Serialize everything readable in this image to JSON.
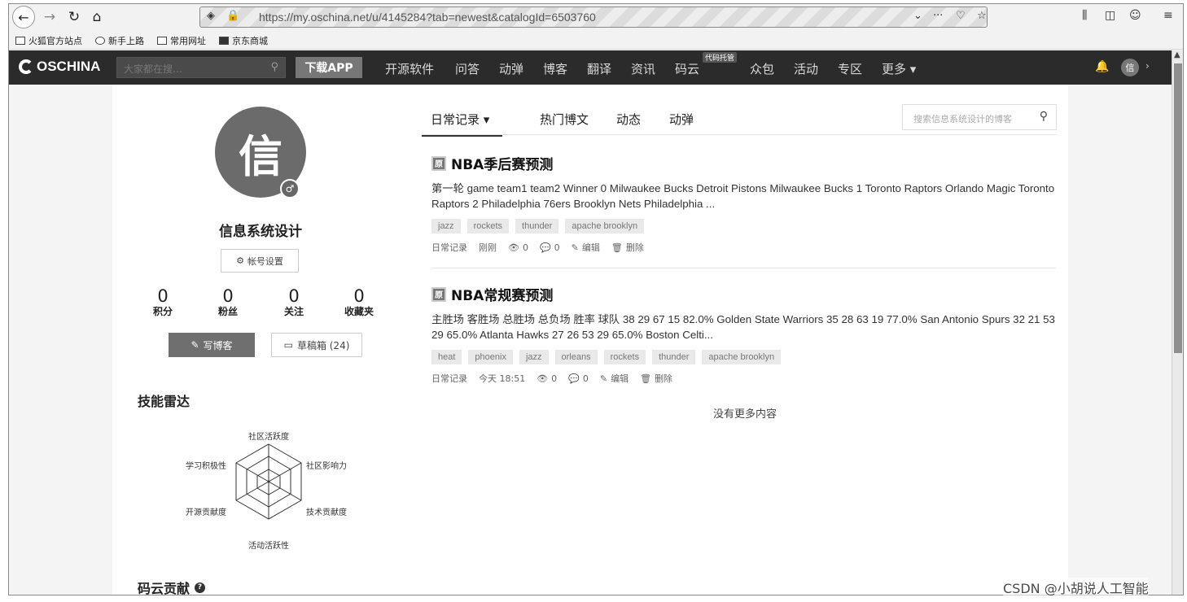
{
  "browser": {
    "url": "https://my.oschina.net/u/4145284?tab=newest&catalogId=6503760",
    "bookmarks": [
      "火狐官方站点",
      "新手上路",
      "常用网址",
      "京东商城"
    ]
  },
  "site": {
    "logo": "OSCHINA",
    "search_placeholder": "大家都在搜…",
    "download_app": "下载APP",
    "nav": [
      "开源软件",
      "问答",
      "动弹",
      "博客",
      "翻译",
      "资讯",
      "码云",
      "众包",
      "活动",
      "专区",
      "更多 ▾"
    ],
    "nav_badge": "代码托管",
    "user_initial": "信"
  },
  "profile": {
    "avatar_char": "信",
    "name": "信息系统设计",
    "account_settings": "帐号设置",
    "stats": [
      {
        "value": "0",
        "label": "积分"
      },
      {
        "value": "0",
        "label": "粉丝"
      },
      {
        "value": "0",
        "label": "关注"
      },
      {
        "value": "0",
        "label": "收藏夹"
      }
    ],
    "write_blog": "写博客",
    "drafts": "草稿箱 (24)",
    "skill_radar_title": "技能雷达",
    "radar_labels": [
      "社区活跃度",
      "社区影响力",
      "技术贡献度",
      "活动活跃性",
      "开源贡献度",
      "学习积极性"
    ],
    "gitee_title": "码云贡献"
  },
  "tabs": {
    "items": [
      "日常记录 ▾",
      "热门博文",
      "动态",
      "动弹"
    ],
    "search_placeholder": "搜索信息系统设计的博客"
  },
  "posts": [
    {
      "type": "原",
      "title": "NBA季后赛预测",
      "summary": "第一轮 game team1 team2 Winner 0 Milwaukee Bucks Detroit Pistons Milwaukee Bucks 1 Toronto Raptors Orlando Magic Toronto Raptors 2 Philadelphia 76ers Brooklyn Nets Philadelphia ...",
      "tags": [
        "jazz",
        "rockets",
        "thunder",
        "apache brooklyn"
      ],
      "category": "日常记录",
      "time": "刚刚",
      "views": "0",
      "comments": "0",
      "edit": "编辑",
      "delete": "删除"
    },
    {
      "type": "原",
      "title": "NBA常规赛预测",
      "summary": "主胜场 客胜场 总胜场 总负场 胜率 球队 38 29 67 15 82.0% Golden State Warriors 35 28 63 19 77.0% San Antonio Spurs 32 21 53 29 65.0% Atlanta Hawks 27 26 53 29 65.0% Boston Celti...",
      "tags": [
        "heat",
        "phoenix",
        "jazz",
        "orleans",
        "rockets",
        "thunder",
        "apache brooklyn"
      ],
      "category": "日常记录",
      "time": "今天 18:51",
      "views": "0",
      "comments": "0",
      "edit": "编辑",
      "delete": "删除"
    }
  ],
  "no_more": "没有更多内容",
  "watermark": "CSDN @小胡说人工智能"
}
